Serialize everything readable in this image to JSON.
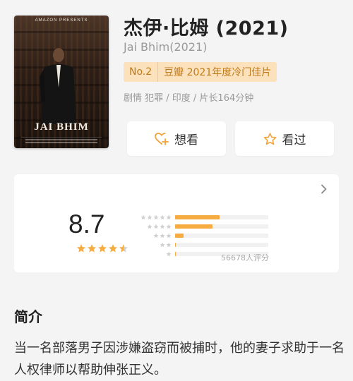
{
  "poster": {
    "header": "AMAZON PRESENTS",
    "title": "JAI BHIM"
  },
  "movie": {
    "title_zh": "杰伊·比姆 (2021)",
    "title_en": "Jai Bhim(2021)",
    "rank": "No.2",
    "rank_text": "豆瓣 2021年度冷门佳片",
    "meta": "剧情 犯罪 / 印度 / 片长164分钟"
  },
  "actions": {
    "want_label": "想看",
    "seen_label": "看过"
  },
  "rating": {
    "score": "8.7",
    "stars": 4.5,
    "count_label": "56678人评分",
    "distribution": [
      {
        "stars": 5,
        "fraction": 0.49
      },
      {
        "stars": 4,
        "fraction": 0.41
      },
      {
        "stars": 3,
        "fraction": 0.09
      },
      {
        "stars": 2,
        "fraction": 0.01
      },
      {
        "stars": 1,
        "fraction": 0.005
      }
    ],
    "colors": {
      "star": "#f6ac40",
      "star_empty": "#d0d0d0",
      "bar": "#f6ac40"
    }
  },
  "intro": {
    "heading": "简介",
    "text": "当一名部落男子因涉嫌盗窃而被捕时，他的妻子求助于一名人权律师以帮助伸张正义。"
  }
}
